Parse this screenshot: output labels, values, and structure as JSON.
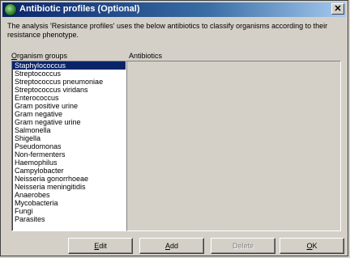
{
  "window": {
    "title": "Antibiotic profiles (Optional)",
    "close_glyph": "✕"
  },
  "description": "The analysis 'Resistance profiles' uses the below antibiotics to classify organisms according to their resistance phenotype.",
  "organism_groups": {
    "label_first": "O",
    "label_rest": "rganism groups",
    "selected_index": 0,
    "items": [
      "Staphylococcus",
      "Streptococcus",
      "Streptococcus pneumoniae",
      "Streptococcus viridans",
      "Enterococcus",
      "Gram positive urine",
      "Gram negative",
      "Gram negative urine",
      "Salmonella",
      "Shigella",
      "Pseudomonas",
      "Non-fermenters",
      "Haemophilus",
      "Campylobacter",
      "Neisseria gonorrhoeae",
      "Neisseria meningitidis",
      "Anaerobes",
      "Mycobacteria",
      "Fungi",
      "Parasites"
    ]
  },
  "antibiotics": {
    "label": "Antibiotics"
  },
  "buttons": {
    "edit": {
      "u": "E",
      "rest": "dit"
    },
    "add": {
      "u": "A",
      "rest": "dd"
    },
    "delete": {
      "u": "",
      "rest": "Delete"
    },
    "ok": {
      "u": "O",
      "rest": "K"
    }
  }
}
